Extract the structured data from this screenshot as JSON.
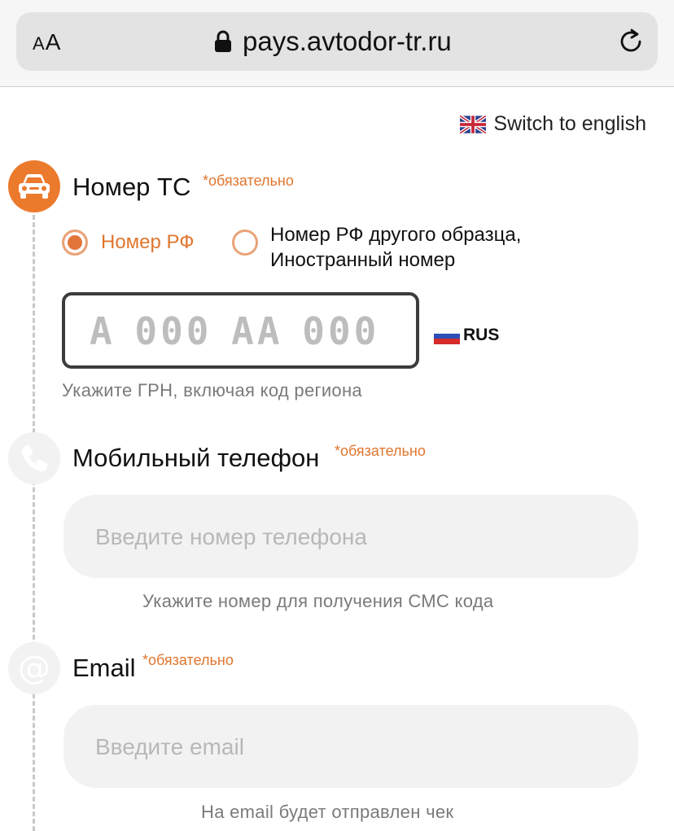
{
  "browser": {
    "aa_small": "A",
    "aa_large": "A",
    "url": "pays.avtodor-tr.ru"
  },
  "lang_switch": {
    "label": "Switch to english"
  },
  "vehicle": {
    "label": "Номер ТС",
    "required": "*обязательно",
    "radio_rf": "Номер РФ",
    "radio_other_line1": "Номер РФ другого образца,",
    "radio_other_line2": "Иностранный номер",
    "radio_rf_selected": true,
    "plate_placeholder": "А 000 АА 000",
    "country_code": "RUS",
    "hint": "Укажите ГРН, включая код региона"
  },
  "phone": {
    "label": "Мобильный телефон",
    "required": "*обязательно",
    "placeholder": "Введите номер телефона",
    "hint": "Укажите номер для получения СМС кода"
  },
  "email": {
    "label": "Email",
    "required": "*обязательно",
    "placeholder": "Введите email",
    "hint": "На email будет отправлен чек"
  },
  "colors": {
    "accent": "#ec7a2d",
    "required_text": "#e0762e",
    "hint_text": "#7a7a7a"
  },
  "icons": {
    "vehicle_step": "car-icon",
    "phone_step": "phone-icon",
    "email_step": "at-icon"
  }
}
